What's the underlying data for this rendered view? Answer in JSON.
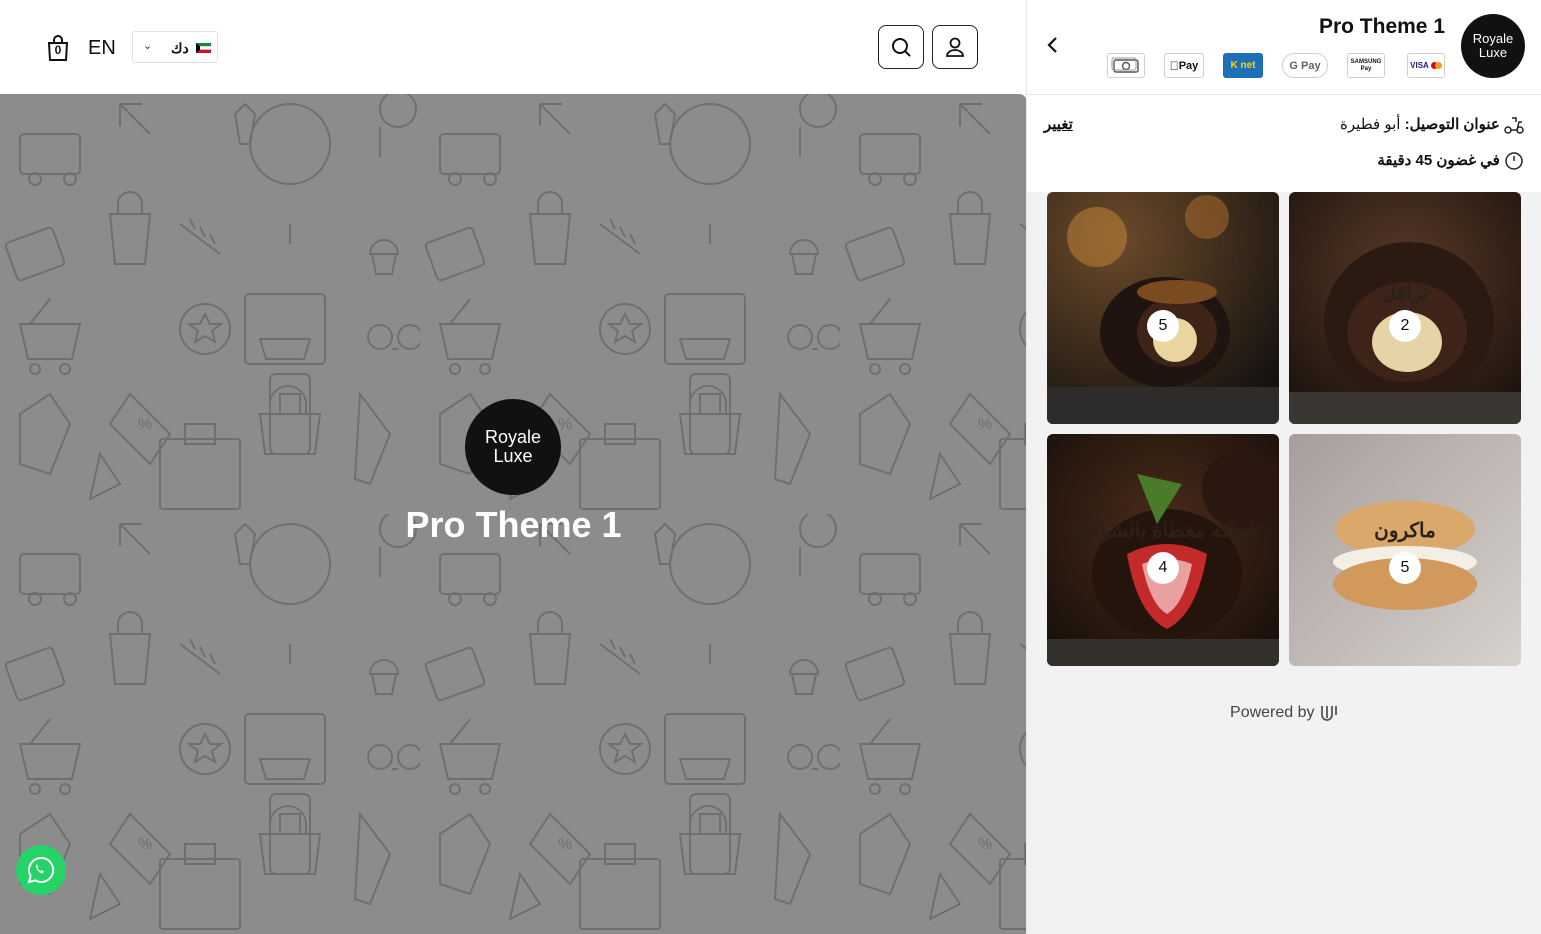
{
  "header": {
    "cart_count": "0",
    "language": "EN",
    "currency": "دك"
  },
  "hero": {
    "logo_line1": "Royale",
    "logo_line2": "Luxe",
    "title": "Pro Theme 1"
  },
  "panel": {
    "store_name": "Pro Theme 1",
    "logo_line1": "Royale",
    "logo_line2": "Luxe",
    "payment_methods": [
      {
        "name": "visa-mastercard",
        "label": "VISA"
      },
      {
        "name": "samsung-pay",
        "label": "SAMSUNG Pay"
      },
      {
        "name": "google-pay",
        "label": "G Pay"
      },
      {
        "name": "knet",
        "label": "K net"
      },
      {
        "name": "apple-pay",
        "label": "Pay"
      },
      {
        "name": "cash",
        "label": ""
      }
    ],
    "address_label": "عنوان التوصيل:",
    "address_value": "أبو فطيرة",
    "change_link": "تغيير",
    "delivery_time": "في غضون 45 دقيقة"
  },
  "categories": [
    {
      "name": "ترافل",
      "count": "2"
    },
    {
      "name": "",
      "count": "5"
    },
    {
      "name": "ماكرون",
      "count": "5"
    },
    {
      "name": "فواكه مغطاة بالشوكولا",
      "count": "4"
    }
  ],
  "footer": {
    "powered_by": "Powered by"
  },
  "colors": {
    "hero_overlay": "#8c8c8c",
    "whatsapp": "#25d366",
    "logo_bg": "#111111"
  }
}
